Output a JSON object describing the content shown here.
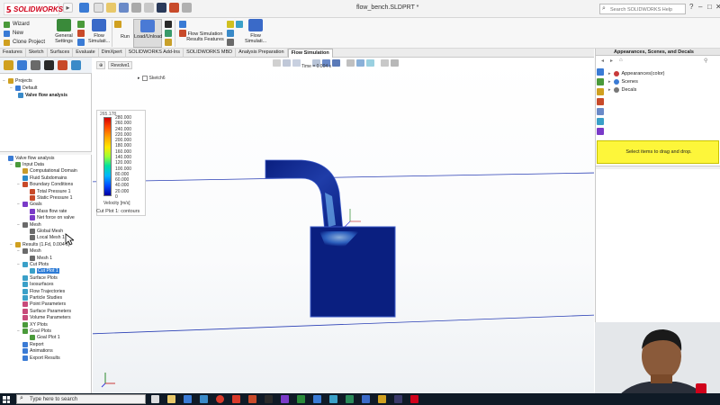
{
  "window": {
    "app_name": "SOLIDWORKS",
    "file_title": "flow_bench.SLDPRT *",
    "search_placeholder": "Search SOLIDWORKS Help"
  },
  "ribbon": {
    "wizard": "Wizard",
    "new": "New",
    "clone_project": "Clone Project",
    "general_settings": [
      "General",
      "Settings"
    ],
    "flow_simulation_1": [
      "Flow",
      "Simulati..."
    ],
    "run": "Run",
    "load_unload": "Load/Unload",
    "results_features": [
      "Flow Simulation",
      "Results Features"
    ],
    "flow_simulation_2": [
      "Flow",
      "Simulati..."
    ]
  },
  "command_tabs": [
    "Features",
    "Sketch",
    "Surfaces",
    "Evaluate",
    "DimXpert",
    "SOLIDWORKS Add-Ins",
    "SOLIDWORKS MBD",
    "Analysis Preparation",
    "Flow Simulation"
  ],
  "active_command_tab": "Flow Simulation",
  "projects_tree": {
    "root": "Projects",
    "default": "Default",
    "project": "Valve flow analysis"
  },
  "analysis_tree": [
    {
      "label": "Valve flow analysis",
      "level": 0,
      "color": "#3a7bd5",
      "expander": ""
    },
    {
      "label": "Input Data",
      "level": 1,
      "color": "#4a9a3a",
      "expander": "−"
    },
    {
      "label": "Computational Domain",
      "level": 2,
      "color": "#c89b2a",
      "expander": ""
    },
    {
      "label": "Fluid Subdomains",
      "level": 2,
      "color": "#2a8ac8",
      "expander": ""
    },
    {
      "label": "Boundary Conditions",
      "level": 2,
      "color": "#c84a2a",
      "expander": "−"
    },
    {
      "label": "Total Pressure 1",
      "level": 3,
      "color": "#c84a2a",
      "expander": ""
    },
    {
      "label": "Static Pressure 1",
      "level": 3,
      "color": "#c84a2a",
      "expander": ""
    },
    {
      "label": "Goals",
      "level": 2,
      "color": "#7a3ac8",
      "expander": "−"
    },
    {
      "label": "Mass flow rate",
      "level": 3,
      "color": "#7a3ac8",
      "expander": ""
    },
    {
      "label": "Net force on valve",
      "level": 3,
      "color": "#7a3ac8",
      "expander": ""
    },
    {
      "label": "Mesh",
      "level": 2,
      "color": "#6a6a6a",
      "expander": "−"
    },
    {
      "label": "Global Mesh",
      "level": 3,
      "color": "#6a6a6a",
      "expander": ""
    },
    {
      "label": "Local Mesh 1",
      "level": 3,
      "color": "#6a6a6a",
      "expander": ""
    },
    {
      "label": "Results (1.Fd, 0.004 s)",
      "level": 1,
      "color": "#d0a020",
      "expander": "−"
    },
    {
      "label": "Mesh",
      "level": 2,
      "color": "#6a6a6a",
      "expander": "−"
    },
    {
      "label": "Mesh 1",
      "level": 3,
      "color": "#6a6a6a",
      "expander": ""
    },
    {
      "label": "Cut Plots",
      "level": 2,
      "color": "#3aa0c8",
      "expander": "−"
    },
    {
      "label": "Cut Plot 1",
      "level": 3,
      "color": "#3aa0c8",
      "expander": "",
      "selected": true
    },
    {
      "label": "Surface Plots",
      "level": 2,
      "color": "#3aa0c8",
      "expander": ""
    },
    {
      "label": "Isosurfaces",
      "level": 2,
      "color": "#3aa0c8",
      "expander": ""
    },
    {
      "label": "Flow Trajectories",
      "level": 2,
      "color": "#3aa0c8",
      "expander": ""
    },
    {
      "label": "Particle Studies",
      "level": 2,
      "color": "#3aa0c8",
      "expander": ""
    },
    {
      "label": "Point Parameters",
      "level": 2,
      "color": "#c84a7a",
      "expander": ""
    },
    {
      "label": "Surface Parameters",
      "level": 2,
      "color": "#c84a7a",
      "expander": ""
    },
    {
      "label": "Volume Parameters",
      "level": 2,
      "color": "#c84a7a",
      "expander": ""
    },
    {
      "label": "XY Plots",
      "level": 2,
      "color": "#4a9a3a",
      "expander": ""
    },
    {
      "label": "Goal Plots",
      "level": 2,
      "color": "#4a9a3a",
      "expander": "−"
    },
    {
      "label": "Goal Plot 1",
      "level": 3,
      "color": "#4a9a3a",
      "expander": ""
    },
    {
      "label": "Report",
      "level": 2,
      "color": "#3a7bd5",
      "expander": ""
    },
    {
      "label": "Animations",
      "level": 2,
      "color": "#3a7bd5",
      "expander": ""
    },
    {
      "label": "Export Results",
      "level": 2,
      "color": "#3a7bd5",
      "expander": ""
    }
  ],
  "viewport": {
    "breadcrumb": "Revolve1",
    "time_label": "Time = 0.004 s",
    "sketch_node": "Sketch6",
    "legend_max": "265.178",
    "legend_ticks": [
      "280.000",
      "260.000",
      "240.000",
      "220.000",
      "200.000",
      "180.000",
      "160.000",
      "140.000",
      "120.000",
      "100.000",
      "80.000",
      "60.000",
      "40.000",
      "20.000",
      "0"
    ],
    "legend_unit": "Velocity [m/s]",
    "cutplot_label": "Cut Plot 1: contours",
    "colors": {
      "fluid_dark": "#0a1f80",
      "fluid_mid": "#1f3ca8",
      "fluid_light": "#7fc8ff",
      "line_blue": "#2a3fb5"
    }
  },
  "right_panel": {
    "title": "Appearances, Scenes, and Decals",
    "items": [
      {
        "label": "Appearances(color)",
        "color": "#c83a3a"
      },
      {
        "label": "Scenes",
        "color": "#3a7bd5"
      },
      {
        "label": "Decals",
        "color": "#777777"
      }
    ],
    "drag_hint": "Select items to drag and drop.",
    "drag_color": "#fdf63a"
  },
  "taskbar": {
    "search_text": "Type here to search"
  },
  "icons": {
    "search": "search-icon",
    "start": "windows-start-icon"
  }
}
